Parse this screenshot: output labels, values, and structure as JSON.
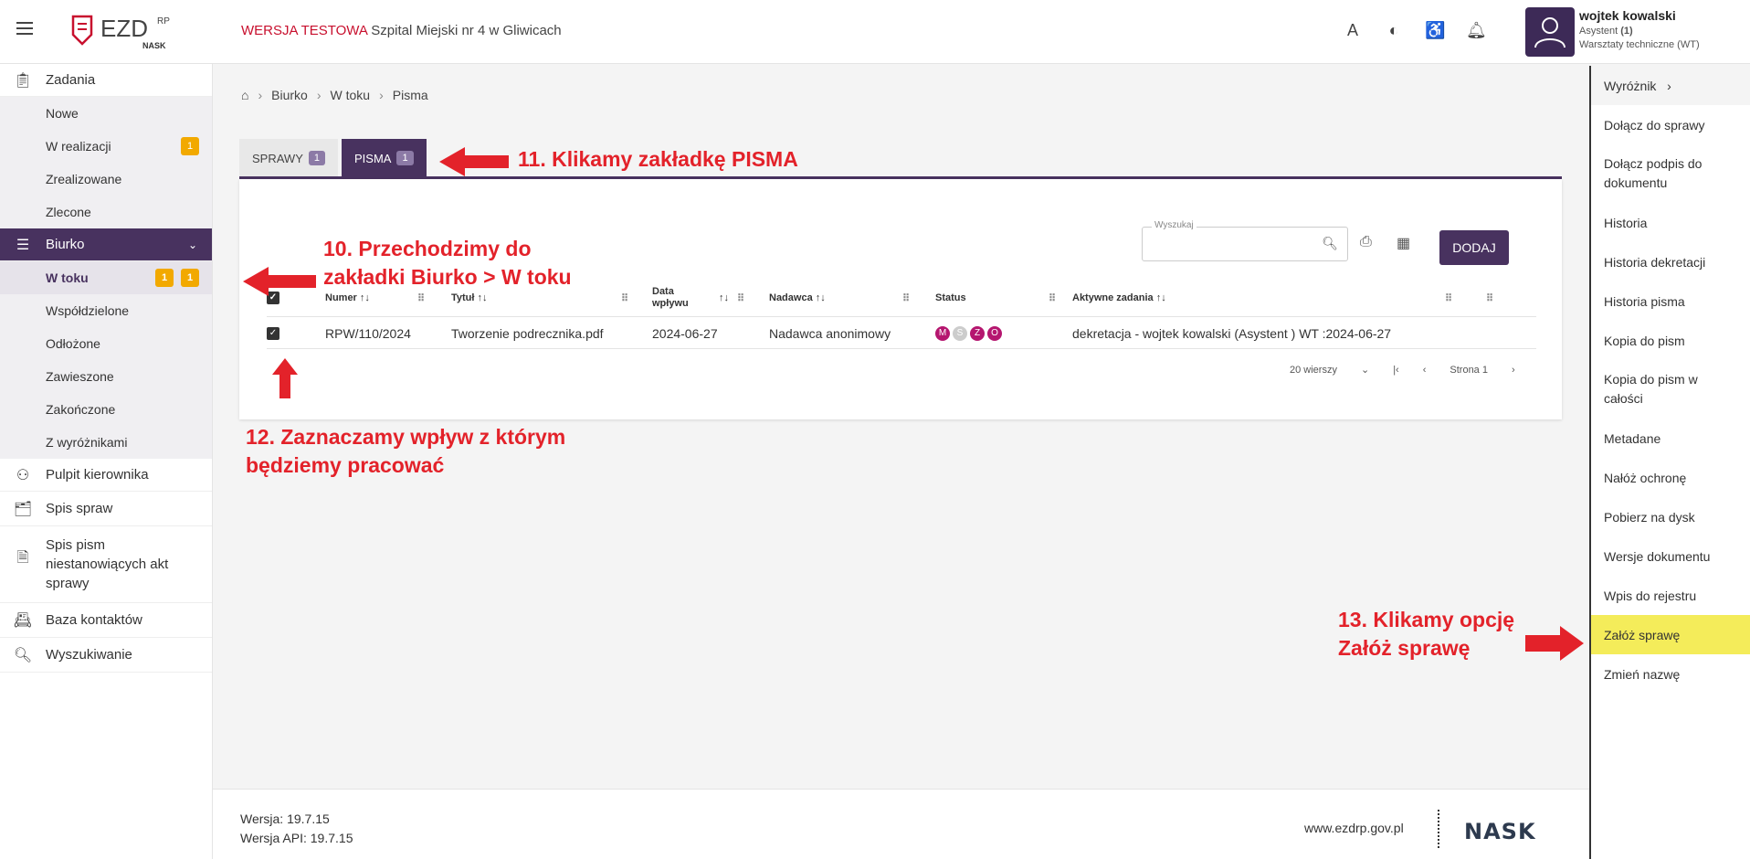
{
  "header": {
    "env_warning": "WERSJA TESTOWA",
    "org_name": "Szpital Miejski nr 4 w Gliwicach",
    "logo_text": "EZD",
    "logo_sup": "RP",
    "logo_sub": "NASK",
    "user": {
      "name": "wojtek kowalski",
      "role_prefix": "Asystent",
      "role_count": "(1)",
      "department": "Warsztaty techniczne (WT)"
    }
  },
  "sidebar": {
    "zadania": "Zadania",
    "zadania_items": [
      "Nowe",
      "W realizacji",
      "Zrealizowane",
      "Zlecone"
    ],
    "w_realizacji_badge": "1",
    "biurko": "Biurko",
    "biurko_items": [
      "W toku",
      "Współdzielone",
      "Odłożone",
      "Zawieszone",
      "Zakończone",
      "Z wyróżnikami"
    ],
    "w_toku_badges": [
      "1",
      "1"
    ],
    "pulpit": "Pulpit kierownika",
    "spis_spraw": "Spis spraw",
    "spis_pism": "Spis pism niestanowiących akt sprawy",
    "baza": "Baza kontaktów",
    "wyszukiwanie": "Wyszukiwanie"
  },
  "breadcrumb": [
    "Biurko",
    "W toku",
    "Pisma"
  ],
  "tabs": [
    {
      "label": "SPRAWY",
      "count": "1"
    },
    {
      "label": "PISMA",
      "count": "1"
    }
  ],
  "search": {
    "label": "Wyszukaj",
    "value": ""
  },
  "add_button": "DODAJ",
  "table": {
    "headers": {
      "numer": "Numer",
      "tytul": "Tytuł",
      "data_line1": "Data",
      "data_line2": "wpływu",
      "nadawca": "Nadawca",
      "status": "Status",
      "aktywne": "Aktywne zadania"
    },
    "rows": [
      {
        "numer": "RPW/110/2024",
        "tytul": "Tworzenie podrecznika.pdf",
        "data": "2024-06-27",
        "nadawca": "Nadawca anonimowy",
        "status": [
          "M",
          "S",
          "Z",
          "O"
        ],
        "aktywne": "dekretacja - wojtek kowalski (Asystent ) WT :2024-06-27"
      }
    ]
  },
  "pager": {
    "rows": "20 wierszy",
    "page": "Strona 1"
  },
  "right_menu": [
    "Wyróżnik",
    "Dołącz do sprawy",
    "Dołącz podpis do dokumentu",
    "Historia",
    "Historia dekretacji",
    "Historia pisma",
    "Kopia do pism",
    "Kopia do pism w całości",
    "Metadane",
    "Nałóż ochronę",
    "Pobierz na dysk",
    "Wersje dokumentu",
    "Wpis do rejestru",
    "Załóż sprawę",
    "Zmień nazwę"
  ],
  "annotations": {
    "a10_line1": "10. Przechodzimy do",
    "a10_line2": "zakładki Biurko > W toku",
    "a11": "11. Klikamy zakładkę PISMA",
    "a12_line1": "12. Zaznaczamy wpływ z którym",
    "a12_line2": "będziemy pracować",
    "a13_line1": "13. Klikamy opcję",
    "a13_line2": "Załóż sprawę"
  },
  "footer": {
    "version": "Wersja: 19.7.15",
    "api_version": "Wersja API: 19.7.15",
    "site": "www.ezdrp.gov.pl",
    "brand": "NASK"
  },
  "colors": {
    "primary": "#48325f",
    "badge": "#f2a900",
    "annotation": "#e3222a",
    "highlight": "#f4ec5a",
    "status_m": "#b5166f",
    "status_s": "#cccccc",
    "status_z": "#b5166f",
    "status_o": "#b5166f"
  }
}
